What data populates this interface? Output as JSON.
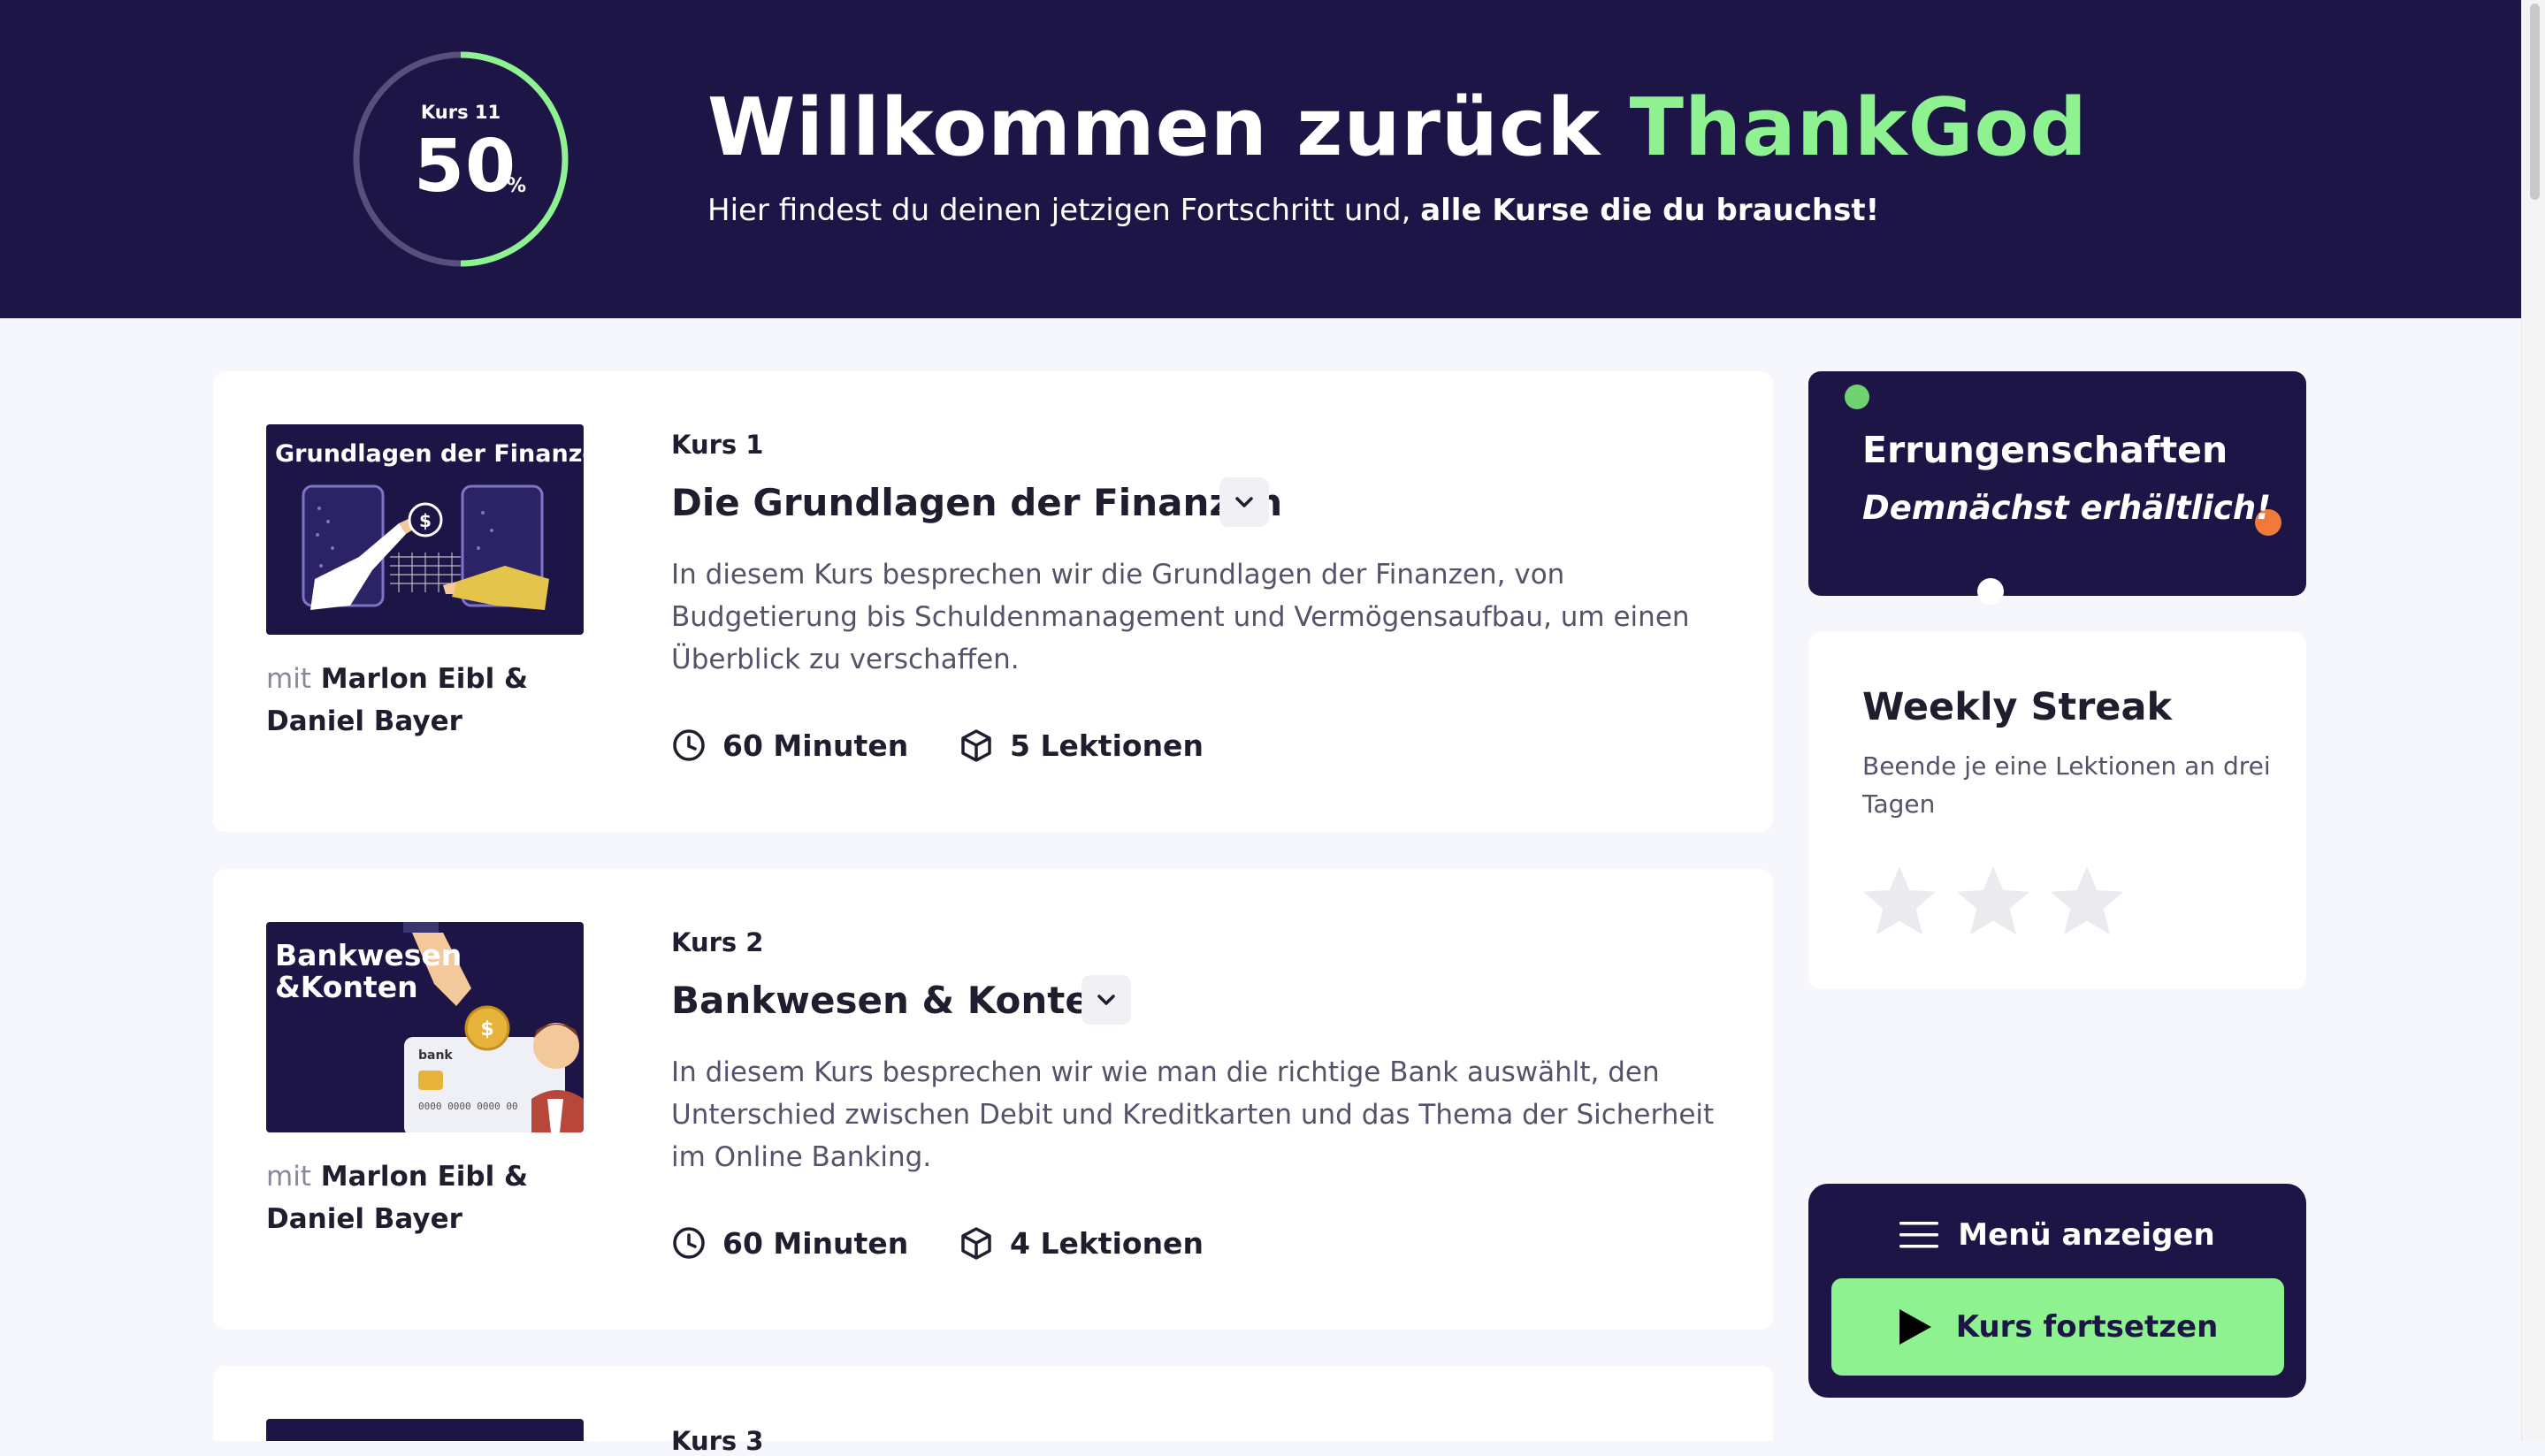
{
  "header": {
    "progress": {
      "label": "Kurs 11",
      "value": "50",
      "unit": "%",
      "fraction": 0.5,
      "track_color": "#57507c",
      "fill_color": "#8ef291"
    },
    "welcome_prefix": "Willkommen zurück",
    "user_name": "ThankGod",
    "subtitle_prefix": "Hier findest du deinen jetzigen Fortschritt und,",
    "subtitle_bold": "alle Kurse die du brauchst!"
  },
  "courses": [
    {
      "thumb_title": "Grundlagen der Finanzen",
      "authors_prefix": "mit",
      "authors_line1": "Marlon Eibl &",
      "authors_line2": "Daniel Bayer",
      "number": "Kurs 1",
      "title": "Die Grundlagen der Finanzen",
      "description": "In diesem Kurs besprechen wir die Grundlagen der Finanzen, von Budgetierung bis Schuldenmanagement und Vermögensaufbau, um einen Überblick zu verschaffen.",
      "duration": "60 Minuten",
      "lessons": "5 Lektionen"
    },
    {
      "thumb_title_line1": "Bankwesen",
      "thumb_title_line2": "&Konten",
      "card_brand": "bank",
      "card_number": "0000 0000 0000 00",
      "authors_prefix": "mit",
      "authors_line1": "Marlon Eibl &",
      "authors_line2": "Daniel Bayer",
      "number": "Kurs 2",
      "title": "Bankwesen & Konten",
      "description": "In diesem Kurs besprechen wir wie man die richtige Bank auswählt, den Unterschied zwischen Debit und Kreditkarten und das Thema der Sicherheit im Online Banking.",
      "duration": "60 Minuten",
      "lessons": "4 Lektionen"
    },
    {
      "number": "Kurs 3"
    }
  ],
  "achievements": {
    "title": "Errungenschaften",
    "subtitle": "Demnächst erhältlich!"
  },
  "streak": {
    "title": "Weekly Streak",
    "description": "Beende je eine Lektionen an drei Tagen",
    "stars_filled": 0,
    "stars_total": 3
  },
  "menu": {
    "toggle_label": "Menü anzeigen",
    "continue_label": "Kurs fortsetzen"
  },
  "colors": {
    "navy": "#1e1547",
    "accent_green": "#8ef291",
    "orange": "#f07a3a"
  }
}
